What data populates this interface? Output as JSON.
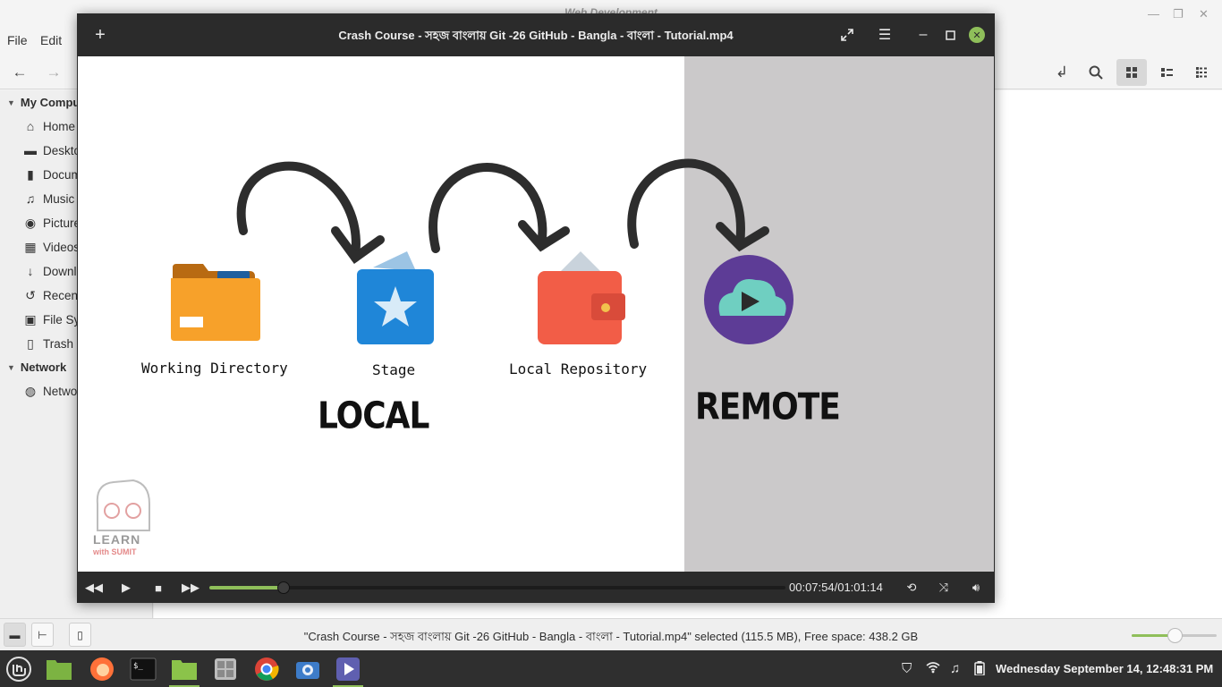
{
  "file_manager": {
    "window_title": "Web Development",
    "menu": {
      "file": "File",
      "edit": "Edit"
    },
    "sidebar": {
      "my_computer_header": "My Computer",
      "my_computer_items": [
        {
          "label": "Home",
          "icon": "home-icon"
        },
        {
          "label": "Desktop",
          "icon": "desktop-icon"
        },
        {
          "label": "Documents",
          "icon": "document-icon"
        },
        {
          "label": "Music",
          "icon": "music-icon"
        },
        {
          "label": "Pictures",
          "icon": "camera-icon"
        },
        {
          "label": "Videos",
          "icon": "film-icon"
        },
        {
          "label": "Downloads",
          "icon": "download-icon"
        },
        {
          "label": "Recent",
          "icon": "recent-icon"
        },
        {
          "label": "File System",
          "icon": "drive-icon"
        },
        {
          "label": "Trash",
          "icon": "trash-icon"
        }
      ],
      "network_header": "Network",
      "network_items": [
        {
          "label": "Network",
          "icon": "globe-icon"
        }
      ]
    },
    "status": "\"Crash Course - সহজ বাংলায় Git -26 GitHub - Bangla - বাংলা - Tutorial.mp4\" selected (115.5 MB), Free space: 438.2 GB",
    "zoom_level": 0.5
  },
  "player": {
    "title": "Crash Course - সহজ বাংলায় Git -26 GitHub - Bangla - বাংলা - Tutorial.mp4",
    "time": "00:07:54/01:01:14",
    "progress": 0.129,
    "video": {
      "labels": {
        "working_directory": "Working Directory",
        "stage": "Stage",
        "local_repository": "Local Repository",
        "local": "LOCAL",
        "remote": "REMOTE"
      },
      "watermark": {
        "line1": "LEARN",
        "line2": "with SUMIT"
      }
    }
  },
  "taskbar": {
    "clock": "Wednesday September 14, 12:48:31 PM"
  },
  "colors": {
    "accent": "#8fbf5a",
    "player_bg": "#2b2b2b",
    "remote_panel": "#cbc9ca"
  }
}
